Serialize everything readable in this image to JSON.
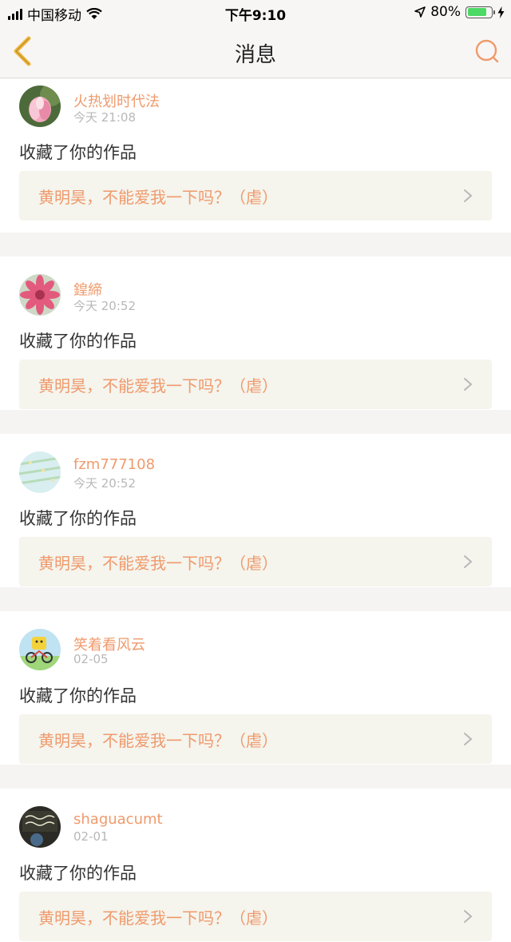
{
  "status_bar": {
    "carrier": "中国移动",
    "time": "下午9:10",
    "battery": "80%",
    "battery_level": 0.8
  },
  "header": {
    "title": "消息"
  },
  "colors": {
    "accent": "#ef9a6c",
    "back_arrow": "#f0b63c",
    "link_bg": "#f5f4ed",
    "page_bg": "#f6f4f3"
  },
  "notifications": [
    {
      "user": "火热划时代法",
      "time": "今天 21:08",
      "action": "收藏了你的作品",
      "work_title": "黄明昊，不能爱我一下吗？（虐）",
      "avatar_icon": "lotus-flower"
    },
    {
      "user": "鍠締",
      "time": "今天 20:52",
      "action": "收藏了你的作品",
      "work_title": "黄明昊，不能爱我一下吗？（虐）",
      "avatar_icon": "pink-flower"
    },
    {
      "user": "fzm777108",
      "time": "今天 20:52",
      "action": "收藏了你的作品",
      "work_title": "黄明昊，不能爱我一下吗？（虐）",
      "avatar_icon": "pastel-pattern"
    },
    {
      "user": "笑着看风云",
      "time": "02-05",
      "action": "收藏了你的作品",
      "work_title": "黄明昊，不能爱我一下吗？（虐）",
      "avatar_icon": "cartoon-bicycle"
    },
    {
      "user": "shaguacumt",
      "time": "02-01",
      "action": "收藏了你的作品",
      "work_title": "黄明昊，不能爱我一下吗？（虐）",
      "avatar_icon": "chalkboard-photo"
    }
  ]
}
